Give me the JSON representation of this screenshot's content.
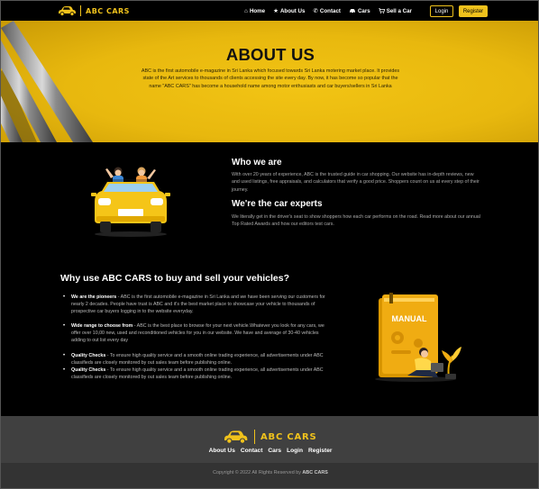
{
  "nav": {
    "brand": "ABC CARS",
    "links": [
      {
        "label": "Home",
        "icon": "home-icon"
      },
      {
        "label": "About Us",
        "icon": "star-icon"
      },
      {
        "label": "Contact",
        "icon": "phone-icon"
      },
      {
        "label": "Cars",
        "icon": "car-icon"
      },
      {
        "label": "Sell a Car",
        "icon": "cart-icon"
      }
    ],
    "login": "Login",
    "register": "Register"
  },
  "hero": {
    "title": "ABOUT US",
    "text": "ABC is the first automobile e-magazine in Sri Lanka which focused towards Sri Lanka motering market place. It provides state of the Art services to thousands of clients accessing the site every day. By now, it has become so popular that the name \"ABC CARS\" has become a household name among motor enthusiasts and car buyers/sellers in Sri Lanka"
  },
  "who": {
    "heading": "Who we are",
    "text": "With over 20 years of experience, ABC is the trusted guide in car shopping. Our website has in-depth reviews, new and used listings, free appraisals, and calculators that verify a good price. Shoppers count on us at every step of their journey.",
    "heading2": "We're the car experts",
    "text2": "We literally get in the driver's seat to show shoppers how each car performs on the road. Read more about our annual Top Rated Awards and how our editors test cars."
  },
  "why": {
    "heading": "Why use ABC CARS to buy and sell your vehicles?",
    "items": [
      {
        "title": "We are the pioneers",
        "text": "ABC is the first automobile e-magazine in Sri Lanka and we have been serving our customers for nearly 2 decades. People have trust is ABC and it's the best market place to showcase your vehicle to thousands of prospective car buyers logging in to the website everyday."
      },
      {
        "title": "Wide range to choose from",
        "text": "ABC is the best place to browse for your next vehicle.Whatever you look for any cars, we offer over 10,00 new, used and reconditioned vehicles for you in our website. We have and average of 30-40 vehicles adding to out list every day"
      },
      {
        "title": "Quality Checks",
        "text": "To ensure high quality service and a smooth online trading experience, all advertisements under ABC classifieds are closely monitored by out sales team before publishing online."
      },
      {
        "title": "Quality Checks",
        "text": "To ensure high quality service and a smooth online trading experience, all advertisements under ABC classifieds are closely monitored by out sales team before publishing online."
      }
    ],
    "manual_label": "MANUAL"
  },
  "footer": {
    "brand": "ABC CARS",
    "links": [
      "About Us",
      "Contact",
      "Cars",
      "Login",
      "Register"
    ],
    "copyright": "Copyright © 2022 All Rights Reserved by",
    "copyright_brand": "ABC CARS"
  },
  "colors": {
    "accent": "#f0c21c",
    "footer": "#404040",
    "background": "#000000"
  }
}
